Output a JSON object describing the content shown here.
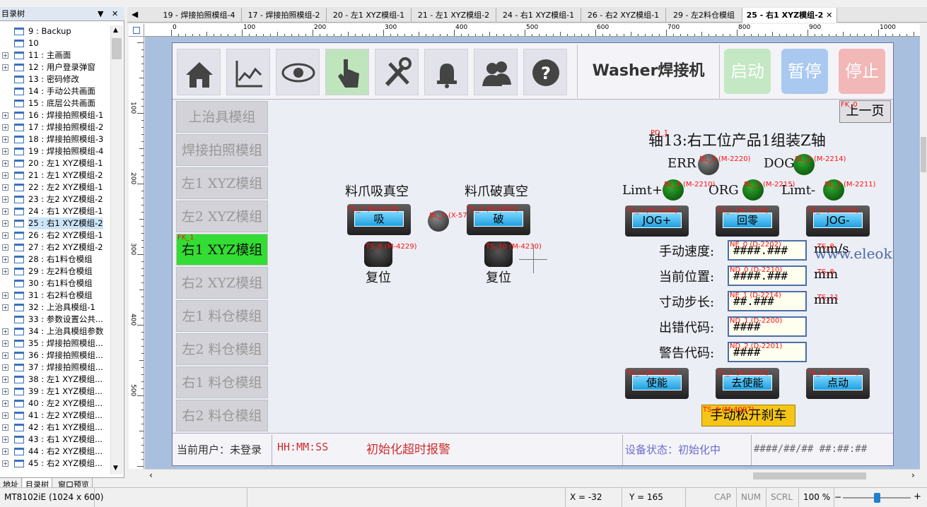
{
  "tree": {
    "title": "目录树",
    "items": [
      {
        "label": "9 : Backup",
        "expandable": false
      },
      {
        "label": "10",
        "expandable": false
      },
      {
        "label": "11 : 主画面",
        "expandable": true
      },
      {
        "label": "12 : 用户登录弹窗",
        "expandable": true
      },
      {
        "label": "13 : 密码修改",
        "expandable": false
      },
      {
        "label": "14 : 手动公共画面",
        "expandable": false
      },
      {
        "label": "15 : 底层公共画面",
        "expandable": false
      },
      {
        "label": "16 : 焊接拍照模组-1",
        "expandable": true
      },
      {
        "label": "17 : 焊接拍照模组-2",
        "expandable": true
      },
      {
        "label": "18 : 焊接拍照模组-3",
        "expandable": true
      },
      {
        "label": "19 : 焊接拍照模组-4",
        "expandable": true
      },
      {
        "label": "20 : 左1 XYZ模组-1",
        "expandable": true
      },
      {
        "label": "21 : 左1 XYZ模组-2",
        "expandable": true
      },
      {
        "label": "22 : 左2 XYZ模组-1",
        "expandable": true
      },
      {
        "label": "23 : 左2 XYZ模组-2",
        "expandable": true
      },
      {
        "label": "24 : 右1 XYZ模组-1",
        "expandable": true
      },
      {
        "label": "25 : 右1 XYZ模组-2",
        "expandable": true,
        "selected": true
      },
      {
        "label": "26 : 右2 XYZ模组-1",
        "expandable": true
      },
      {
        "label": "27 : 右2 XYZ模组-2",
        "expandable": true
      },
      {
        "label": "28 : 右1料仓模组",
        "expandable": true
      },
      {
        "label": "29 : 左2料仓模组",
        "expandable": true
      },
      {
        "label": "30 : 右1料仓模组",
        "expandable": false
      },
      {
        "label": "31 : 右2料仓模组",
        "expandable": true
      },
      {
        "label": "32 : 上治具模组-1",
        "expandable": true
      },
      {
        "label": "33 : 参数设置公共...",
        "expandable": false
      },
      {
        "label": "34 : 上治具模组参数",
        "expandable": true
      },
      {
        "label": "35 : 焊接拍照模组...",
        "expandable": true
      },
      {
        "label": "36 : 焊接拍照模组...",
        "expandable": true
      },
      {
        "label": "37 : 焊接拍照模组...",
        "expandable": true
      },
      {
        "label": "38 : 左1 XYZ模组...",
        "expandable": true
      },
      {
        "label": "39 : 左1 XYZ模组...",
        "expandable": true
      },
      {
        "label": "40 : 左2 XYZ模组...",
        "expandable": true
      },
      {
        "label": "41 : 左2 XYZ模组...",
        "expandable": true
      },
      {
        "label": "42 : 右1 XYZ模组...",
        "expandable": true
      },
      {
        "label": "43 : 右1 XYZ模组...",
        "expandable": true
      },
      {
        "label": "44 : 右2 XYZ模组...",
        "expandable": true
      },
      {
        "label": "45 : 右2 XYZ模组...",
        "expandable": true
      }
    ],
    "tabs": [
      "地址",
      "目录树",
      "窗口预览"
    ]
  },
  "tabs": [
    "19 - 焊接拍照模组-4",
    "17 - 焊接拍照模组-2",
    "20 - 左1 XYZ模组-1",
    "21 - 左1 XYZ模组-2",
    "24 - 右1 XYZ模组-1",
    "26 - 右2 XYZ模组-1",
    "29 - 左2料仓模组",
    "25 - 右1 XYZ模组-2"
  ],
  "ruler_labels": [
    "0",
    "100",
    "200",
    "300",
    "400",
    "500",
    "600",
    "700",
    "800",
    "900",
    "1000"
  ],
  "ruler_left_labels": [
    "100",
    "200",
    "300",
    "400",
    "500"
  ],
  "hmi": {
    "title": "Washer焊接机",
    "top_buttons": {
      "start": "启动",
      "pause": "暂停",
      "stop": "停止"
    },
    "nav_icons": [
      "home-icon",
      "chart-icon",
      "eye-icon",
      "hand-pointer-icon",
      "tools-icon",
      "alarm-bell-icon",
      "users-icon",
      "help-icon"
    ],
    "side_menu": [
      "上治具模组",
      "焊接拍照模组",
      "左1 XYZ模组",
      "左2 XYZ模组",
      "右1 XYZ模组",
      "右2 XYZ模组",
      "左1 料仓模组",
      "左2 料仓模组",
      "右1 料仓模组",
      "右2 料仓模组"
    ],
    "side_menu_tag": "FK_1",
    "prev_page": "上一页",
    "prev_page_tag": "FK_0",
    "axis_title": "轴13:右工位产品1组装Z轴",
    "axis_title_tag": "PD_1",
    "vacuum_on_label": "料爪吸真空",
    "vacuum_off_label": "料爪破真空",
    "btn_suck": {
      "tag": "TS_7 (M-4029)",
      "label": "吸"
    },
    "btn_break": {
      "tag": "TS_9 (M-4030)",
      "label": "破"
    },
    "lamp_center_tag": "BL_5 (X-57)",
    "reset1": {
      "tag": "TS_8 (M-4229)",
      "label": "复位"
    },
    "reset2": {
      "tag": "TS_10 (M-4230)",
      "label": "复位"
    },
    "err_label": "ERR",
    "err_tag": "BL_0 (M-2220)",
    "dog_label": "DOG",
    "dog_tag": "BL_2 (M-2214)",
    "limp_label": "Limt+",
    "limp_tag": "BL_4 (M-2210)",
    "org_label": "ORG",
    "org_tag": "BL_1 (M-2215)",
    "limm_label": "Limt-",
    "limm_tag": "BL_3 (M-2211)",
    "jog_plus": {
      "tag": "TS_3 (M-2208)",
      "label": "JOG+"
    },
    "home": {
      "tag": "TS_1 (M-2218)",
      "label": "回零"
    },
    "jog_minus": {
      "tag": "TS_5 (M-2209)",
      "label": "JOG-"
    },
    "fields": [
      {
        "label": "手动速度:",
        "tag": "NE_0 (D-2202)",
        "value": "####.###",
        "unit": "mm/s",
        "unit_tag": "TS_8"
      },
      {
        "label": "当前位置:",
        "tag": "ND_0 (D-2210)",
        "value": "####.###",
        "unit": "mm",
        "unit_tag": "TS_8"
      },
      {
        "label": "寸动步长:",
        "tag": "NE_1 (D-2214)",
        "value": "##.###",
        "unit": "mm",
        "unit_tag": "TS_11"
      },
      {
        "label": "出错代码:",
        "tag": "ND_1 (D-2200)",
        "value": "####",
        "unit": "",
        "unit_tag": ""
      },
      {
        "label": "警告代码:",
        "tag": "ND_2 (D-2201)",
        "value": "####",
        "unit": "",
        "unit_tag": ""
      }
    ],
    "enable": {
      "tag": "TS_0 (M-2201)",
      "label": "使能"
    },
    "disable": {
      "tag": "TS_2 (M-2202)",
      "label": "去使能"
    },
    "inch": {
      "tag": "TS_4 (M-2217)",
      "label": "点动"
    },
    "brake": {
      "tag": "TS_6 (M-4097)",
      "label": "手动松开刹车"
    },
    "watermark": "www.eleok.com",
    "status": {
      "user": "当前用户：未登录",
      "time": "HH:MM:SS",
      "alarm": "初始化超时报警",
      "device": "设备状态：初始化中",
      "datetime": "####/##/## ##:##:##"
    }
  },
  "app_status": {
    "model": "MT8102iE (1024 x 600)",
    "x": "X = -32",
    "y": "Y = 165",
    "cap": "CAP",
    "num": "NUM",
    "scrl": "SCRL",
    "zoom": "100 %"
  },
  "colors": {
    "accent": "#1f9fe0",
    "active_menu": "#33dd33",
    "tag_red": "#ff1010",
    "start_btn": "#c3e8c3",
    "pause_btn": "#a9c9f0",
    "stop_btn": "#f2b7b7",
    "brake_btn": "#f5c518"
  }
}
